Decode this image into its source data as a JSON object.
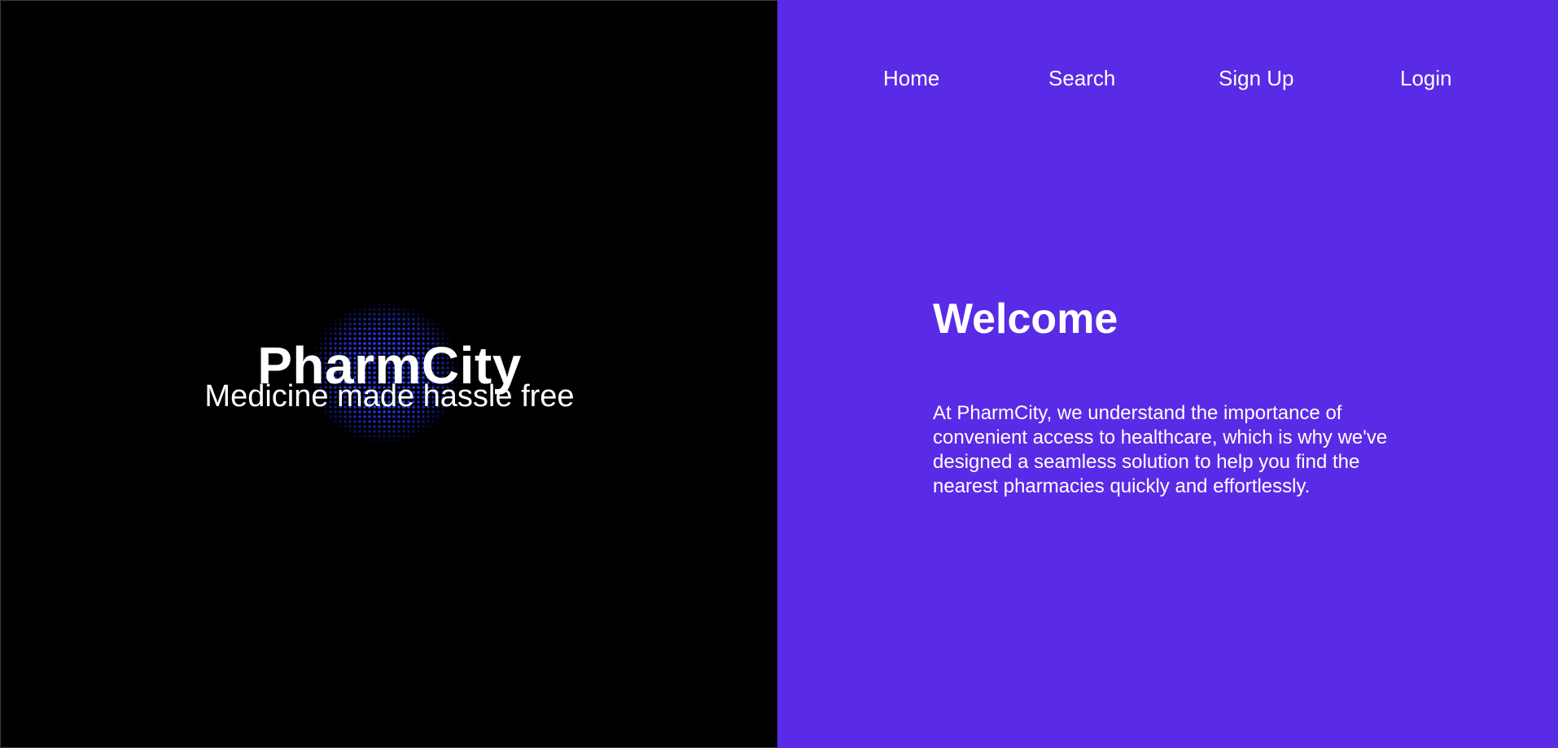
{
  "brand": {
    "name": "PharmCity",
    "tagline": "Medicine made hassle free"
  },
  "nav": {
    "items": [
      {
        "label": "Home"
      },
      {
        "label": "Search"
      },
      {
        "label": "Sign Up"
      },
      {
        "label": "Login"
      }
    ]
  },
  "welcome": {
    "title": "Welcome",
    "body": "At PharmCity, we understand the importance of convenient access to healthcare, which is why we've designed a seamless solution to help you find the nearest pharmacies quickly and effortlessly."
  },
  "colors": {
    "left_background": "#000000",
    "right_background": "#5a2be6",
    "accent_dots": "#2a3cff",
    "text": "#ffffff"
  },
  "icons": {
    "hero_graphic": "dotted-globe-graphic"
  }
}
